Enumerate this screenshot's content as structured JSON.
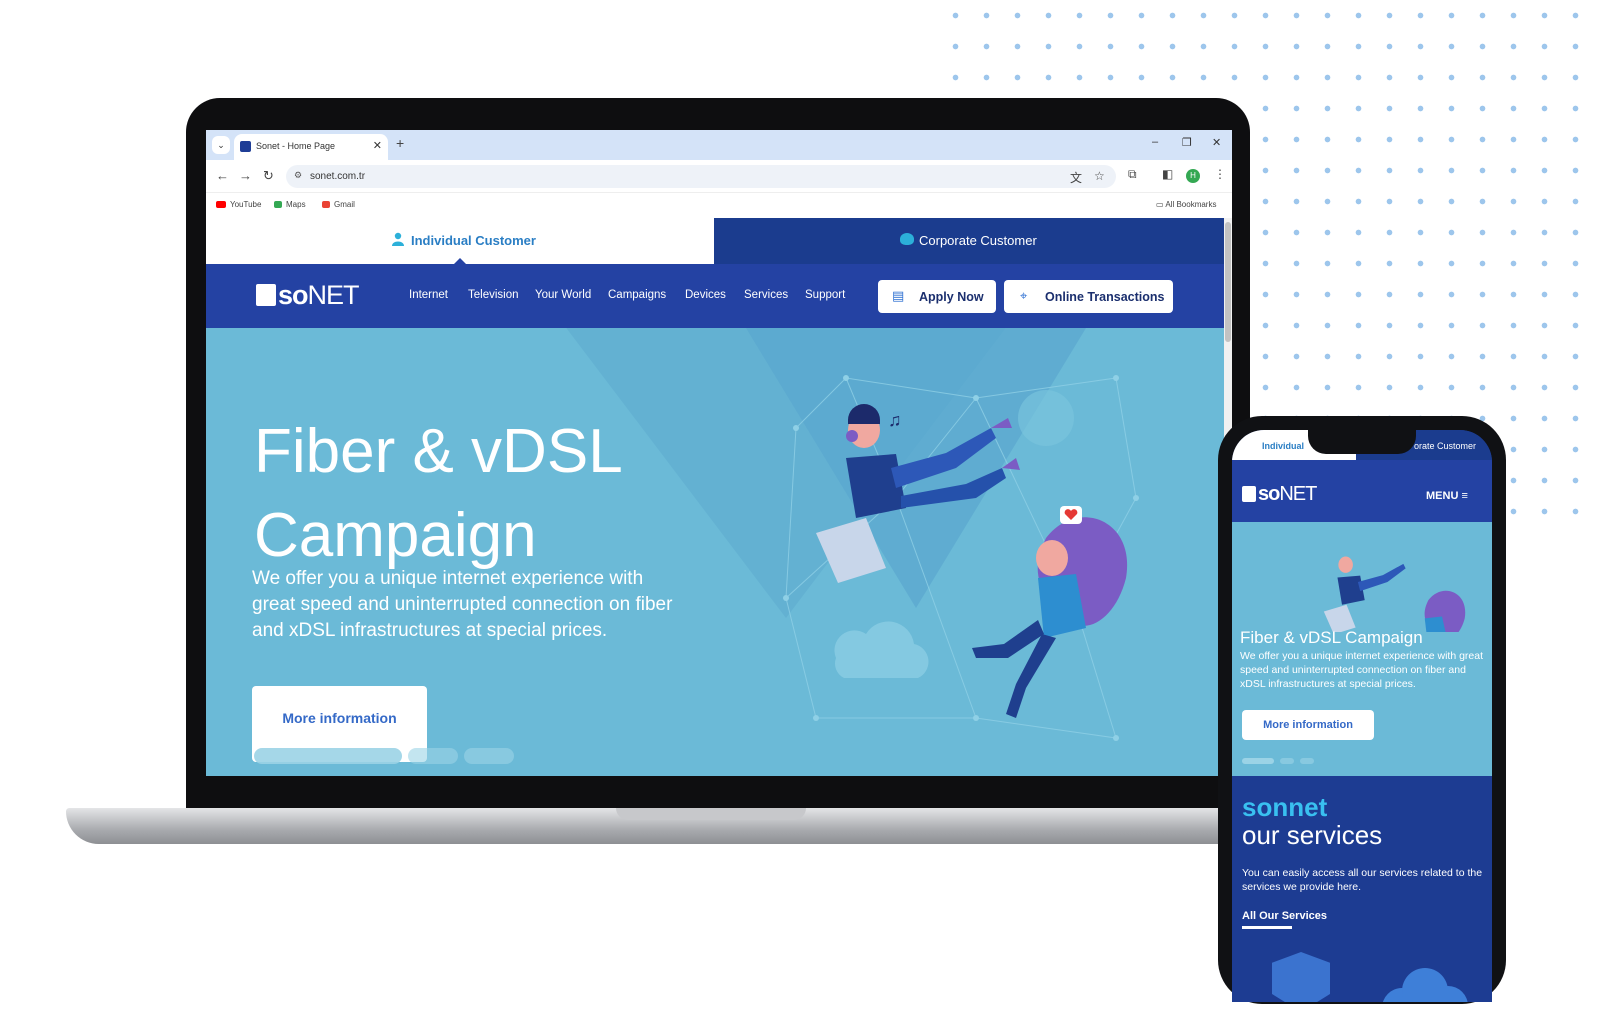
{
  "browser": {
    "tab_title": "Sonet - Home Page",
    "tab_close": "✕",
    "new_tab": "+",
    "url": "sonet.com.tr",
    "bookmarks": [
      {
        "label": "YouTube",
        "color": "#ff0000"
      },
      {
        "label": "Maps",
        "color": "#34a853"
      },
      {
        "label": "Gmail",
        "color": "#ea4335"
      }
    ],
    "all_bookmarks": "All Bookmarks",
    "profile_initial": "H",
    "window_controls": {
      "minimize": "–",
      "restore": "❐",
      "close": "✕"
    },
    "nav": {
      "back": "←",
      "forward": "→",
      "reload": "↻"
    },
    "icons": {
      "translate": "文",
      "star": "☆",
      "extensions": "⧉",
      "sidebar": "◧",
      "menu": "⋮",
      "tune": "⚙",
      "folder": "▭"
    }
  },
  "site": {
    "customer_tabs": {
      "individual": "Individual Customer",
      "corporate": "Corporate Customer"
    },
    "logo": {
      "bold": "so",
      "thin": "NET"
    },
    "nav": [
      "Internet",
      "Television",
      "Your World",
      "Campaigns",
      "Devices",
      "Services",
      "Support"
    ],
    "apply_now": "Apply Now",
    "online_transactions": "Online Transactions",
    "hero": {
      "title_line1": "Fiber & vDSL",
      "title_line2": "Campaign",
      "subtitle": "We offer you a unique internet experience with great speed and uninterrupted connection on fiber and xDSL infrastructures at special prices.",
      "button": "More information"
    }
  },
  "phone": {
    "customer_tabs": {
      "individual": "Individual",
      "corporate": "orate Customer"
    },
    "menu": "MENU ≡",
    "hero": {
      "title": "Fiber & vDSL Campaign",
      "subtitle": "We offer you a unique internet experience with great speed and uninterrupted connection on fiber and xDSL infrastructures at special prices.",
      "button": "More information"
    },
    "services": {
      "brand": "sonnet",
      "title": "our services",
      "description": "You can easily access all our services related to the services we provide here.",
      "link": "All Our Services"
    }
  },
  "colors": {
    "brand_blue": "#2442a3",
    "corporate_blue": "#1b3c8e",
    "hero_teal": "#6bbad7",
    "accent_cyan": "#39c0f0"
  }
}
